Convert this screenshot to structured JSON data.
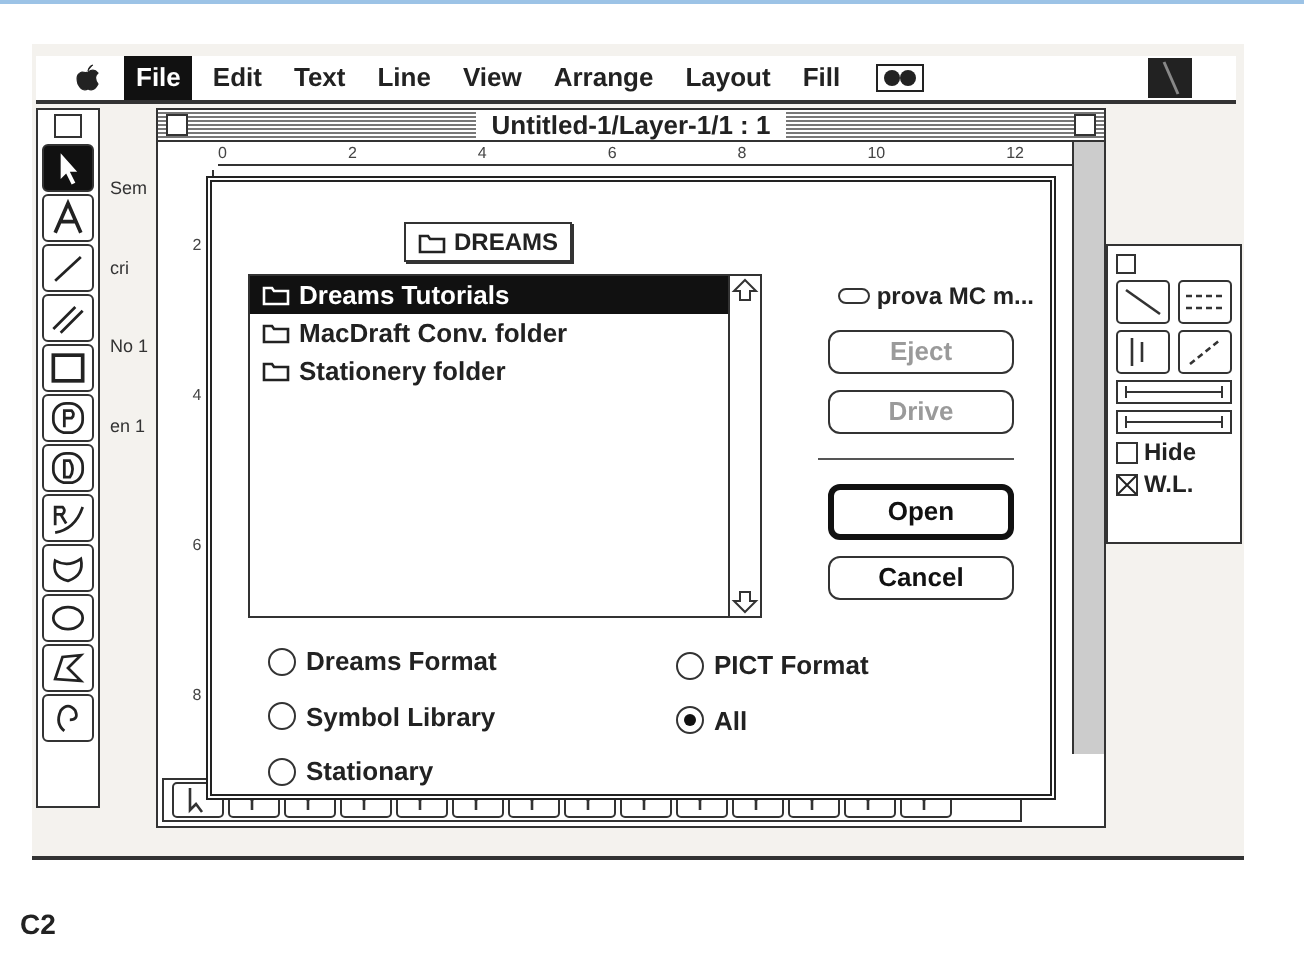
{
  "menu_bar": {
    "items": [
      {
        "label": "File",
        "selected": true
      },
      {
        "label": "Edit",
        "selected": false
      },
      {
        "label": "Text",
        "selected": false
      },
      {
        "label": "Line",
        "selected": false
      },
      {
        "label": "View",
        "selected": false
      },
      {
        "label": "Arrange",
        "selected": false
      },
      {
        "label": "Layout",
        "selected": false
      },
      {
        "label": "Fill",
        "selected": false
      }
    ]
  },
  "document_window": {
    "title": "Untitled-1/Layer-1/1 : 1",
    "top_ruler": [
      "0",
      "2",
      "4",
      "6",
      "8",
      "10",
      "12"
    ],
    "left_ruler": [
      "2",
      "4",
      "6",
      "8"
    ],
    "background_fragments": [
      "Sem",
      "cri",
      "No 1",
      "en 1"
    ]
  },
  "dialog": {
    "folder_popup": "DREAMS",
    "files": [
      {
        "name": "Dreams Tutorials",
        "selected": true
      },
      {
        "name": "MacDraft Conv. folder",
        "selected": false
      },
      {
        "name": "Stationery folder",
        "selected": false
      }
    ],
    "disk": "prova MC m...",
    "buttons": [
      {
        "label": "Eject",
        "disabled": true,
        "default": false
      },
      {
        "label": "Drive",
        "disabled": true,
        "default": false
      },
      {
        "label": "Open",
        "disabled": false,
        "default": true
      },
      {
        "label": "Cancel",
        "disabled": false,
        "default": false
      }
    ],
    "formats": [
      {
        "label": "Dreams Format",
        "selected": false
      },
      {
        "label": "Symbol Library",
        "selected": false
      },
      {
        "label": "Stationary",
        "selected": false
      },
      {
        "label": "PICT Format",
        "selected": false
      },
      {
        "label": "All",
        "selected": true
      }
    ]
  },
  "line_palette": {
    "checkboxes": [
      {
        "label": "Hide",
        "checked": false
      },
      {
        "label": "W.L.",
        "checked": true
      }
    ]
  },
  "caption": "C2"
}
